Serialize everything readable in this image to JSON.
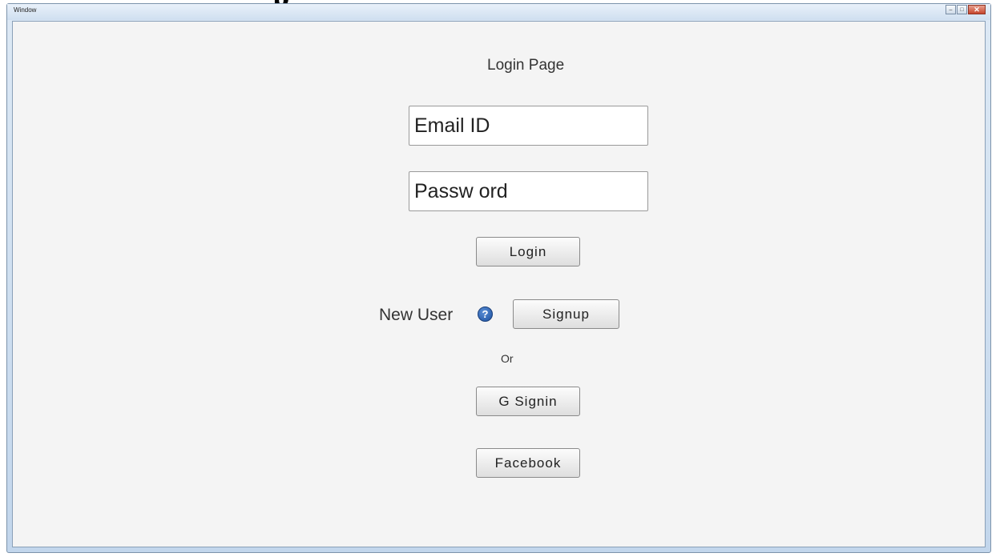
{
  "page": {
    "heading_fragment": "p"
  },
  "window": {
    "title": "Window",
    "controls": {
      "minimize": "–",
      "maximize": "□",
      "close": "✕"
    }
  },
  "login": {
    "heading": "Login Page",
    "email_placeholder": "Email ID",
    "password_placeholder": "Passw ord",
    "login_button": "Login",
    "new_user_label": "New User",
    "help_icon": "?",
    "signup_button": "Signup",
    "or_label": "Or",
    "google_button": "G Signin",
    "facebook_button": "Facebook"
  },
  "icons": {
    "help": "help-icon",
    "minimize": "minimize-icon",
    "maximize": "maximize-icon",
    "close": "close-icon"
  },
  "colors": {
    "help_icon": "#2a5fb0",
    "close_button": "#c6452d",
    "client_background": "#f4f4f4"
  }
}
